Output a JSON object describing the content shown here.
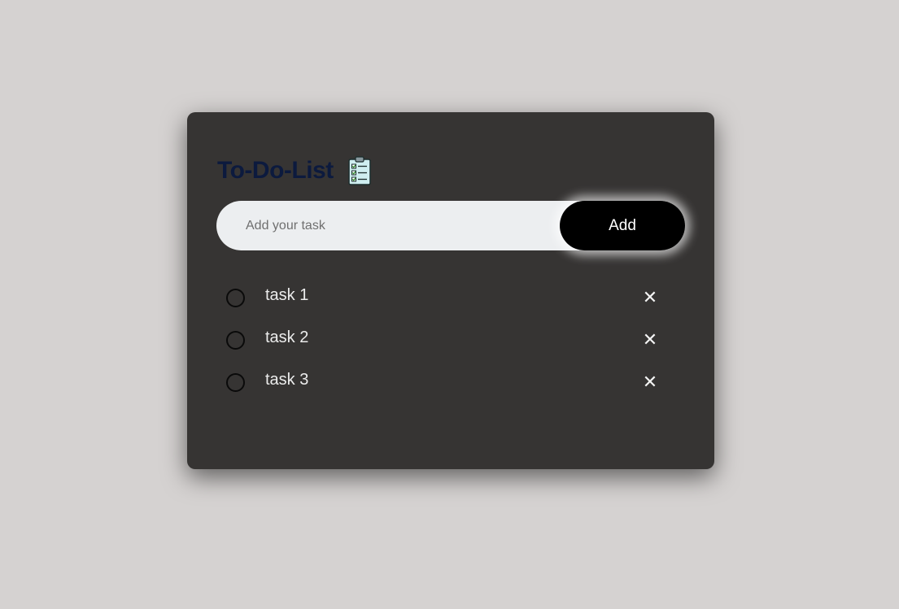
{
  "header": {
    "title": "To-Do-List",
    "icon": "clipboard-checklist-icon"
  },
  "input": {
    "placeholder": "Add your task",
    "value": "",
    "add_label": "Add"
  },
  "tasks": [
    {
      "text": "task 1",
      "done": false,
      "delete_symbol": "✕"
    },
    {
      "text": "task 2",
      "done": false,
      "delete_symbol": "✕"
    },
    {
      "text": "task 3",
      "done": false,
      "delete_symbol": "✕"
    }
  ],
  "colors": {
    "background": "#d5d2d1",
    "card": "#363433",
    "title": "#0c1a3e",
    "input_bg": "#eceef0",
    "button_bg": "#000000",
    "task_text": "#ececec"
  }
}
